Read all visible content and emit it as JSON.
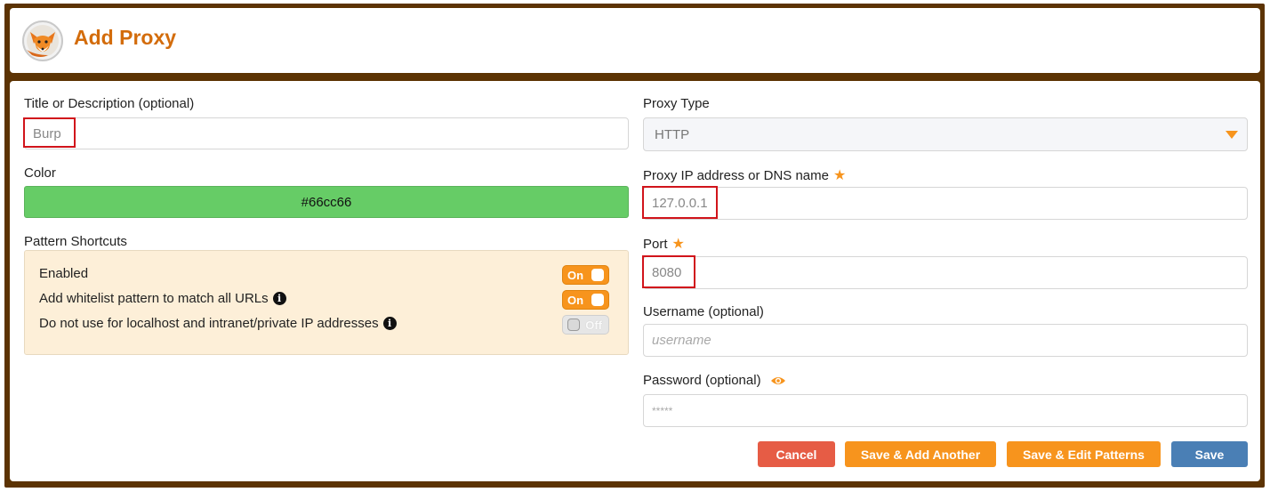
{
  "header": {
    "title": "Add Proxy",
    "logo_icon": "fox-logo-icon"
  },
  "form": {
    "title_label": "Title or Description (optional)",
    "title_value": "Burp",
    "color_label": "Color",
    "color_value": "#66cc66",
    "shortcuts_label": "Pattern Shortcuts",
    "shortcuts": [
      {
        "label": "Enabled",
        "info": false,
        "state": "On",
        "on": true
      },
      {
        "label": "Add whitelist pattern to match all URLs",
        "info": true,
        "state": "On",
        "on": true
      },
      {
        "label": "Do not use for localhost and intranet/private IP addresses",
        "info": true,
        "state": "Off",
        "on": false
      }
    ],
    "proxy_type_label": "Proxy Type",
    "proxy_type_value": "HTTP",
    "ip_label": "Proxy IP address or DNS name",
    "ip_value": "127.0.0.1",
    "port_label": "Port",
    "port_value": "8080",
    "username_label": "Username (optional)",
    "username_placeholder": "username",
    "password_label": "Password (optional)",
    "password_placeholder": "*****"
  },
  "buttons": {
    "cancel": "Cancel",
    "save_add": "Save & Add Another",
    "save_edit": "Save & Edit Patterns",
    "save": "Save"
  },
  "colors": {
    "frame": "#5c3303",
    "accent": "#f7941d",
    "title": "#d36c0b",
    "cancel": "#e65c45",
    "save": "#4a7fb5",
    "highlight": "#d1141b"
  }
}
